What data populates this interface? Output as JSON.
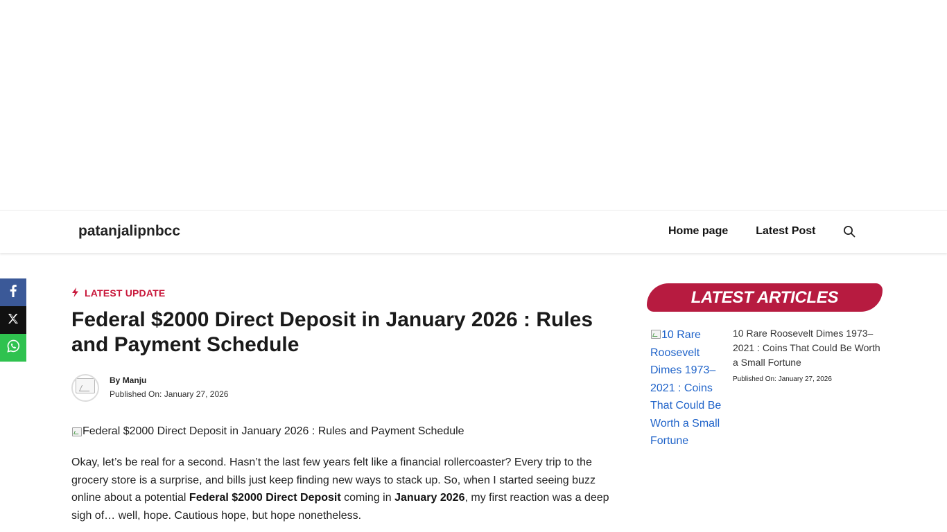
{
  "header": {
    "site_title": "patanjalipnbcc",
    "nav": [
      {
        "label": "Home page"
      },
      {
        "label": "Latest Post"
      }
    ]
  },
  "share": {
    "icons": [
      "facebook-icon",
      "x-icon",
      "whatsapp-icon"
    ],
    "colors": {
      "facebook": "#3b5998",
      "x": "#111111",
      "whatsapp": "#2fc24f"
    }
  },
  "article": {
    "category": "LATEST UPDATE",
    "title": "Federal $2000 Direct Deposit in January 2026 : Rules and Payment Schedule",
    "author_prefix": "By",
    "author": "Manju",
    "date_prefix": "Published On:",
    "date": "January 27, 2026",
    "image_alt": "Federal $2000 Direct Deposit in January 2026 : Rules and Payment Schedule",
    "intro": {
      "part1": "Okay, let’s be real for a second. Hasn’t the last few years felt like a financial rollercoaster? Every trip to the grocery store is a surprise, and bills just keep finding new ways to stack up. So, when I started seeing buzz online about a potential ",
      "bold1": "Federal $2000 Direct Deposit",
      "part2": " coming in ",
      "bold2": "January 2026",
      "part3": ", my first reaction was a deep sigh of… well, hope. Cautious hope, but hope nonetheless."
    }
  },
  "sidebar": {
    "heading": "LATEST ARTICLES",
    "accent_color": "#b71b40",
    "posts": [
      {
        "image_alt": "10 Rare Roosevelt Dimes 1973–2021 : Coins That Could Be Worth a Small Fortune",
        "title": "10 Rare Roosevelt Dimes 1973–2021 : Coins That Could Be Worth a Small Fortune",
        "date_prefix": "Published On:",
        "date": "January 27, 2026"
      }
    ]
  }
}
